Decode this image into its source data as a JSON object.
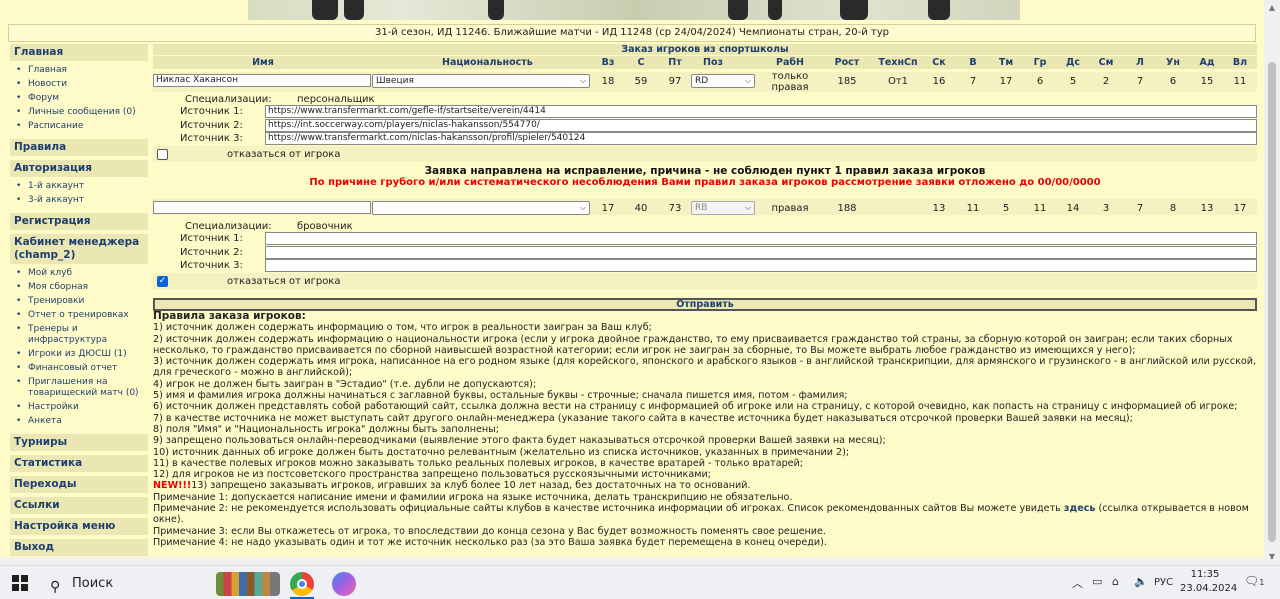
{
  "info_bar": "31-й сезон, ИД 11246. Ближайшие матчи - ИД 11248 (ср 24/04/2024) Чемпионаты стран, 20-й тур",
  "sidebar": {
    "sections": [
      {
        "label": "Главная",
        "items": [
          "Главная",
          "Новости",
          "Форум",
          "Личные сообщения (0)",
          "Расписание"
        ]
      },
      {
        "label": "Правила",
        "items": []
      },
      {
        "label": "Авторизация",
        "items": [
          "1-й аккаунт",
          "3-й аккаунт"
        ]
      },
      {
        "label": "Регистрация",
        "items": []
      },
      {
        "label": "Кабинет менеджера (champ_2)",
        "items": [
          "Мой клуб",
          "Моя сборная",
          "Тренировки",
          "Отчет о тренировках",
          "Тренеры и инфраструктура",
          "Игроки из ДЮСШ (1)",
          "Финансовый отчет",
          "Приглашения на товарищеский матч (0)",
          "Настройки",
          "Анкета"
        ]
      },
      {
        "label": "Турниры",
        "items": []
      },
      {
        "label": "Статистика",
        "items": []
      },
      {
        "label": "Переходы",
        "items": []
      },
      {
        "label": "Ссылки",
        "items": []
      },
      {
        "label": "Настройка меню",
        "items": []
      },
      {
        "label": "Выход",
        "items": []
      }
    ]
  },
  "form": {
    "title": "Заказ игроков из спортшколы",
    "headers": [
      "Имя",
      "Национальность",
      "Вз",
      "С",
      "Пт",
      "Поз",
      "РабН",
      "Рост",
      "ТехнСп",
      "Ск",
      "В",
      "Тм",
      "Гр",
      "Дс",
      "См",
      "Л",
      "Ун",
      "Ад",
      "Вл"
    ],
    "player1": {
      "name": "Никлас Хакансон",
      "nationality": "Швеция",
      "vz": "18",
      "s": "59",
      "pt": "97",
      "pos": "RD",
      "foot": "только правая",
      "height": "185",
      "tech": "От1",
      "stats": [
        "16",
        "7",
        "17",
        "6",
        "5",
        "2",
        "7",
        "6",
        "15",
        "11"
      ],
      "spec_label": "Специализации:",
      "spec_value": "персональщик",
      "sources": [
        {
          "label": "Источник 1:",
          "value": "https://www.transfermarkt.com/gefle-if/startseite/verein/4414"
        },
        {
          "label": "Источник 2:",
          "value": "https://int.soccerway.com/players/niclas-hakansson/554770/"
        },
        {
          "label": "Источник 3:",
          "value": "https://www.transfermarkt.com/niclas-hakansson/profil/spieler/540124"
        }
      ],
      "refuse_label": "отказаться от игрока",
      "refuse_checked": false
    },
    "notice": "Заявка направлена на исправление, причина - не соблюден пункт 1 правил заказа игроков",
    "warning": "По причине грубого и/или систематического несоблюдения Вами правил заказа игроков рассмотрение заявки отложено до 00/00/0000",
    "player2": {
      "name": "",
      "nationality": "",
      "vz": "17",
      "s": "40",
      "pt": "73",
      "pos": "RB",
      "foot": "правая",
      "height": "188",
      "tech": "",
      "stats": [
        "13",
        "11",
        "5",
        "11",
        "14",
        "3",
        "7",
        "8",
        "13",
        "17"
      ],
      "spec_label": "Специализации:",
      "spec_value": "бровочник",
      "sources": [
        {
          "label": "Источник 1:",
          "value": ""
        },
        {
          "label": "Источник 2:",
          "value": ""
        },
        {
          "label": "Источник 3:",
          "value": ""
        }
      ],
      "refuse_label": "отказаться от игрока",
      "refuse_checked": true
    },
    "submit_label": "Отправить"
  },
  "rules": {
    "title": "Правила заказа игроков:",
    "lines": [
      "1) источник должен содержать информацию о том, что игрок в реальности заигран за Ваш клуб;",
      "2) источник должен содержать информацию о национальности игрока (если у игрока двойное гражданство, то ему присваивается гражданство той страны, за сборную которой он заигран; если таких сборных несколько, то гражданство присваивается по сборной наивысшей возрастной категории; если игрок не заигран за сборные, то Вы можете выбрать любое гражданство из имеющихся у него);",
      "3) источник должен содержать имя игрока, написанное на его родном языке (для корейского, японского и арабского языков - в английской транскрипции, для армянского и грузинского - в английской или русской, для греческого - можно в английской);",
      "4) игрок не должен быть заигран в \"Эстадио\" (т.е. дубли не допускаются);",
      "5) имя и фамилия игрока должны начинаться с заглавной буквы, остальные буквы - строчные; сначала пишется имя, потом - фамилия;",
      "6) источник должен представлять собой работающий сайт, ссылка должна вести на страницу с информацией об игроке или на страницу, с которой очевидно, как попасть на страницу с информацией об игроке;",
      "7) в качестве источника не может выступать сайт другого онлайн-менеджера (указание такого сайта в качестве источника будет наказываться отсрочкой проверки Вашей заявки на месяц);",
      "8) поля \"Имя\" и \"Национальность игрока\" должны быть заполнены;",
      "9) запрещено пользоваться онлайн-переводчиками (выявление этого факта будет наказываться отсрочкой проверки Вашей заявки на месяц);",
      "10) источник данных об игроке должен быть достаточно релевантным (желательно из списка источников, указанных в примечании 2);",
      "11) в качестве полевых игроков можно заказывать только реальных полевых игроков, в качестве вратарей - только вратарей;",
      "12) для игроков не из постсоветского пространства запрещено пользоваться русскоязычными источниками;"
    ],
    "new_tag": "NEW!!!",
    "line13": "13) запрещено заказывать игроков, игравших за клуб более 10 лет назад, без достаточных на то оснований.",
    "note1": "Примечание 1: допускается написание имени и фамилии игрока на языке источника, делать транскрипцию не обязательно.",
    "note2_a": "Примечание 2: не рекомендуется использовать официальные сайты клубов в качестве источника информации об игроках. Список рекомендованных сайтов Вы можете увидеть",
    "note2_link": "здесь",
    "note2_b": "(ссылка открывается в новом окне).",
    "note3": "Примечание 3: если Вы откажетесь от игрока, то впоследствии до конца сезона у Вас будет возможность поменять свое решение.",
    "note4": "Примечание 4: не надо указывать один и тот же источник несколько раз (за это Ваша заявка будет перемещена в конец очереди)."
  },
  "taskbar": {
    "search_label": "Поиск",
    "lang": "РУС",
    "time": "11:35",
    "date": "23.04.2024",
    "notif_count": "1"
  }
}
